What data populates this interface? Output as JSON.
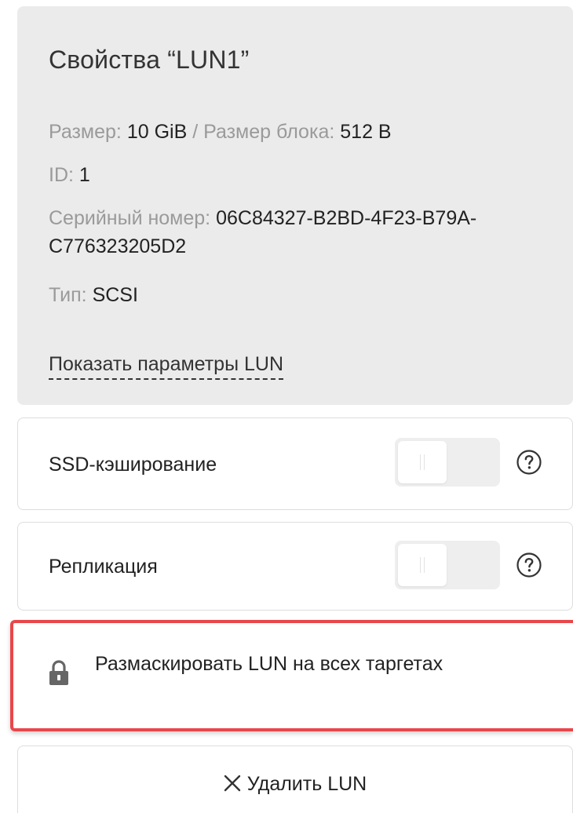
{
  "properties": {
    "title": "Свойства “LUN1”",
    "size_label": "Размер:",
    "size_value": "10 GiB",
    "separator": "/",
    "block_size_label": "Размер блока:",
    "block_size_value": "512 B",
    "id_label": "ID:",
    "id_value": "1",
    "serial_label": "Серийный номер:",
    "serial_value": "06C84327-B2BD-4F23-B79A-C776323205D2",
    "type_label": "Тип:",
    "type_value": "SCSI",
    "show_params_link": "Показать параметры LUN"
  },
  "options": {
    "ssd_caching": {
      "label": "SSD-кэширование",
      "enabled": false,
      "help_icon": "question-circle-icon"
    },
    "replication": {
      "label": "Репликация",
      "enabled": false,
      "help_icon": "question-circle-icon"
    }
  },
  "actions": {
    "unmask": {
      "label": "Размаскировать LUN на всех таргетах",
      "icon": "lock-icon",
      "highlight_color": "#e8474b"
    },
    "delete": {
      "label": "Удалить LUN",
      "icon": "close-icon"
    }
  },
  "colors": {
    "panel_background": "#ebebeb",
    "label_gray": "#9a9a9a",
    "text": "#222222"
  }
}
